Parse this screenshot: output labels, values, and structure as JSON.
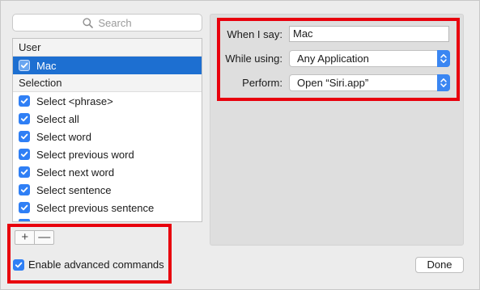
{
  "search": {
    "placeholder": "Search"
  },
  "list": {
    "groups": [
      {
        "header": "User",
        "items": [
          {
            "label": "Mac",
            "checked": true,
            "selected": true
          }
        ]
      },
      {
        "header": "Selection",
        "items": [
          {
            "label": "Select <phrase>",
            "checked": true
          },
          {
            "label": "Select all",
            "checked": true
          },
          {
            "label": "Select word",
            "checked": true
          },
          {
            "label": "Select previous word",
            "checked": true
          },
          {
            "label": "Select next word",
            "checked": true
          },
          {
            "label": "Select sentence",
            "checked": true
          },
          {
            "label": "Select previous sentence",
            "checked": true
          }
        ]
      }
    ]
  },
  "controls": {
    "add": "+",
    "remove": "—"
  },
  "enable": {
    "label": "Enable advanced commands",
    "checked": true
  },
  "form": {
    "when_label": "When I say:",
    "when_value": "Mac",
    "using_label": "While using:",
    "using_value": "Any Application",
    "perform_label": "Perform:",
    "perform_value": "Open “Siri.app”"
  },
  "done_label": "Done",
  "colors": {
    "accent": "#2f7ff5",
    "selection": "#1d6fd1",
    "highlight": "#e8000d"
  }
}
